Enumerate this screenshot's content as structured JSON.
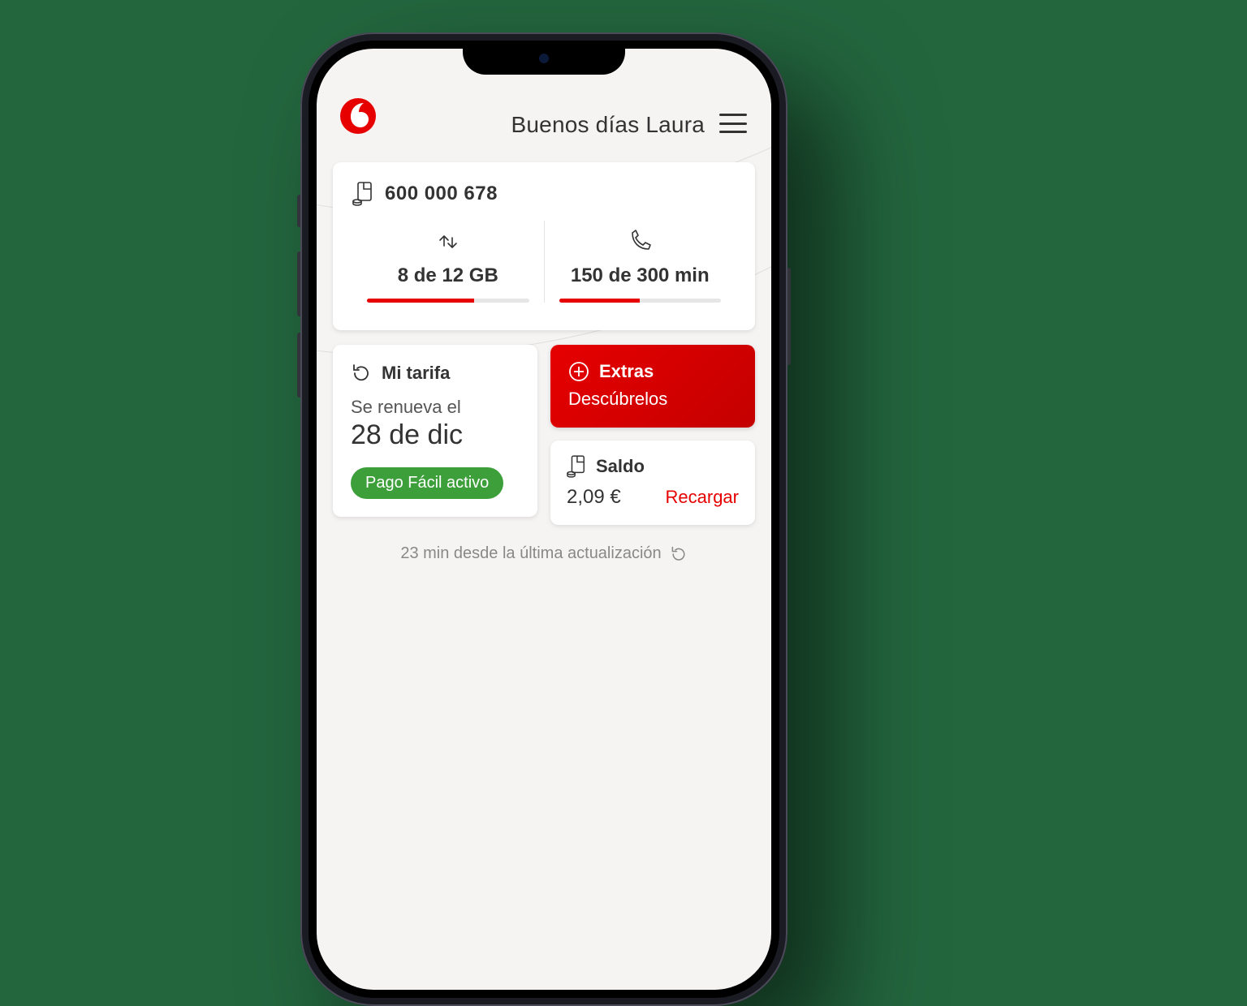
{
  "header": {
    "greeting": "Buenos días Laura"
  },
  "usage": {
    "phone_number": "600 000 678",
    "data": {
      "label": "8 de 12 GB",
      "used": 8,
      "total": 12,
      "pct": 66
    },
    "minutes": {
      "label": "150 de 300 min",
      "used": 150,
      "total": 300,
      "pct": 50
    }
  },
  "tarifa": {
    "title": "Mi tarifa",
    "renews_label": "Se renueva el",
    "renews_date": "28 de dic",
    "pill": "Pago Fácil activo"
  },
  "extras": {
    "title": "Extras",
    "subtitle": "Descúbrelos"
  },
  "saldo": {
    "title": "Saldo",
    "amount": "2,09 €",
    "action": "Recargar"
  },
  "footer": {
    "text": "23 min desde la última actualización"
  },
  "colors": {
    "brand_red": "#e60000",
    "green": "#3c9f3a"
  }
}
